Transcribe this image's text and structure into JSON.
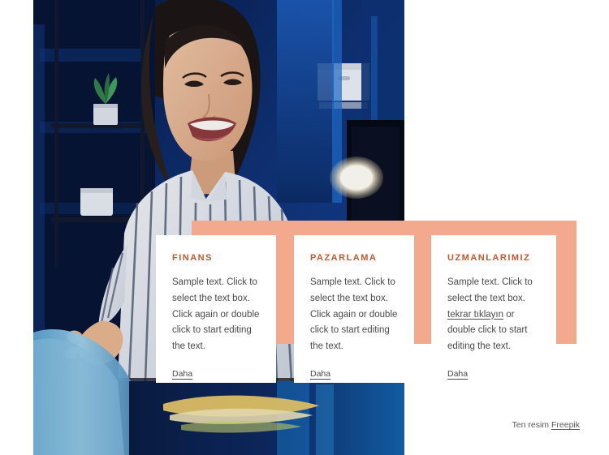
{
  "hero": {
    "alt": "smiling-woman-at-desk-photo",
    "palette": {
      "deep_blue": "#0b1f4e",
      "mid_blue": "#123a86",
      "bright_blue": "#1565c0",
      "light_blue": "#9fd6ef",
      "skin": "#e8bb9a",
      "shirt_light": "#e9eaee",
      "shirt_stripe": "#5a6276",
      "hair_dark": "#241c1a",
      "lamp_glow": "#f6f2e6",
      "plant_green": "#3f8f55",
      "desk_dark": "#0a0a10",
      "mug_blue": "#7fb9de",
      "paper_yellow": "#e8c86a"
    }
  },
  "accent": {
    "name": "peach-panel",
    "color": "#f2a98e"
  },
  "colors": {
    "heading": "#c4572f",
    "body_text": "#4a4a4a",
    "card_background": "#ffffff",
    "page_background": "#ffffff"
  },
  "cards": [
    {
      "id": "finans",
      "title": "FINANS",
      "body_before": "Sample text. Click to select the text box. Click again or double click to start editing the text.",
      "inline_link": "",
      "body_after": "",
      "more_label": "Daha"
    },
    {
      "id": "pazarlama",
      "title": "PAZARLAMA",
      "body_before": "Sample text. Click to select the text box. Click again or double click to start editing the text.",
      "inline_link": "",
      "body_after": "",
      "more_label": "Daha"
    },
    {
      "id": "uzmanlarimiz",
      "title": "UZMANLARIMIZ",
      "body_before": "Sample text. Click to select the text box. ",
      "inline_link": "tekrar tıklayın",
      "body_after": " or double click to start editing the text.",
      "more_label": "Daha"
    }
  ],
  "attribution": {
    "prefix": "Ten resim ",
    "link": "Freepik"
  }
}
